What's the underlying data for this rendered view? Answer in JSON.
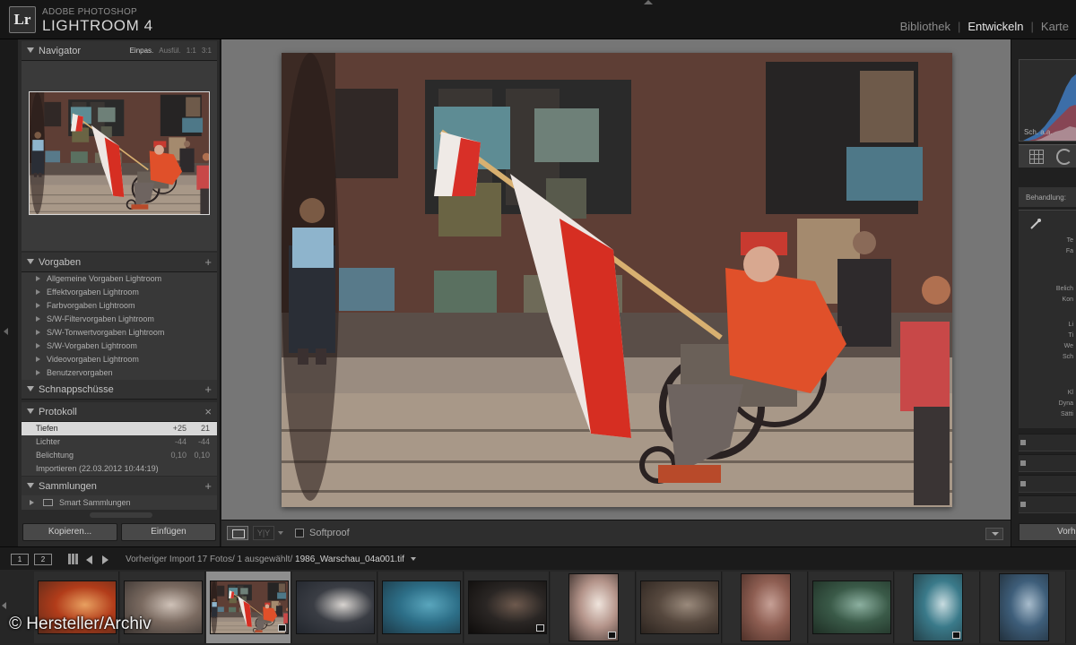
{
  "app": {
    "brand_top": "ADOBE PHOTOSHOP",
    "brand_main": "LIGHTROOM 4",
    "logo": "Lr",
    "modules": [
      "Bibliothek",
      "Entwickeln",
      "Karte"
    ],
    "active_module": "Entwickeln"
  },
  "navigator": {
    "title": "Navigator",
    "options": [
      "Einpas.",
      "Ausfül.",
      "1:1",
      "3:1"
    ]
  },
  "presets": {
    "title": "Vorgaben",
    "items": [
      "Allgemeine Vorgaben Lightroom",
      "Effektvorgaben Lightroom",
      "Farbvorgaben Lightroom",
      "S/W-Filtervorgaben Lightroom",
      "S/W-Tonwertvorgaben Lightroom",
      "S/W-Vorgaben Lightroom",
      "Videovorgaben Lightroom",
      "Benutzervorgaben"
    ]
  },
  "snapshots": {
    "title": "Schnappschüsse"
  },
  "history": {
    "title": "Protokoll",
    "items": [
      {
        "label": "Tiefen",
        "v1": "+25",
        "v2": "21"
      },
      {
        "label": "Lichter",
        "v1": "-44",
        "v2": "-44"
      },
      {
        "label": "Belichtung",
        "v1": "0,10",
        "v2": "0,10"
      },
      {
        "label": "Importieren (22.03.2012 10:44:19)",
        "v1": "",
        "v2": ""
      }
    ]
  },
  "collections": {
    "title": "Sammlungen",
    "items": [
      "Smart Sammlungen"
    ]
  },
  "left_buttons": {
    "copy": "Kopieren...",
    "paste": "Einfügen"
  },
  "toolbar": {
    "softproof": "Softproof"
  },
  "right_panel": {
    "hist_label": "Sch. a.a.",
    "section_title": "Behandlung:",
    "texts": [
      "Te",
      "Fa",
      "Belich",
      "Kon",
      "Li",
      "Ti",
      "We",
      "Sch",
      "Kl",
      "Dyna",
      "Sätti"
    ],
    "button": "Vorh"
  },
  "filmstrip_bar": {
    "source": "Vorheriger Import",
    "count": "17 Fotos/ 1 ausgewählt/",
    "filename": "1986_Warschau_04a001.tif",
    "pages": [
      "1",
      "2"
    ]
  },
  "filmstrip": {
    "selected_index": 2,
    "thumbs": [
      {
        "name": "thumb-orange-portrait",
        "colors": [
          "#b23c1a",
          "#e8a060",
          "#5a2a1a"
        ]
      },
      {
        "name": "thumb-street-crowd",
        "colors": [
          "#7a6a60",
          "#cfc2b8",
          "#3b3532"
        ]
      },
      {
        "name": "thumb-flag-wheelchair",
        "colors": [
          "#6b4a3a",
          "#e0d6cc",
          "#c9321e"
        ]
      },
      {
        "name": "thumb-market-people",
        "colors": [
          "#3a3d44",
          "#d8d4d0",
          "#22262d"
        ]
      },
      {
        "name": "thumb-blue-car",
        "colors": [
          "#2d6f88",
          "#5aa6bd",
          "#1d3a48"
        ]
      },
      {
        "name": "thumb-cafe-night",
        "colors": [
          "#2a2624",
          "#6e5a4e",
          "#0e0c0b"
        ]
      },
      {
        "name": "thumb-motorbike",
        "colors": [
          "#b4948a",
          "#efe4dc",
          "#3a2e2a"
        ]
      },
      {
        "name": "thumb-alley",
        "colors": [
          "#56483e",
          "#9a8a7c",
          "#2c241f"
        ]
      },
      {
        "name": "thumb-ruins",
        "colors": [
          "#8e5e52",
          "#c6a096",
          "#4e3028"
        ]
      },
      {
        "name": "thumb-river-people",
        "colors": [
          "#3a5a48",
          "#8cb0a0",
          "#1e2e24"
        ]
      },
      {
        "name": "thumb-children-group",
        "colors": [
          "#3a7a8a",
          "#c8dce0",
          "#244048"
        ]
      },
      {
        "name": "thumb-family",
        "colors": [
          "#3e5e7a",
          "#a8bccc",
          "#22303c"
        ]
      }
    ]
  },
  "watermark": "© Hersteller/Archiv"
}
